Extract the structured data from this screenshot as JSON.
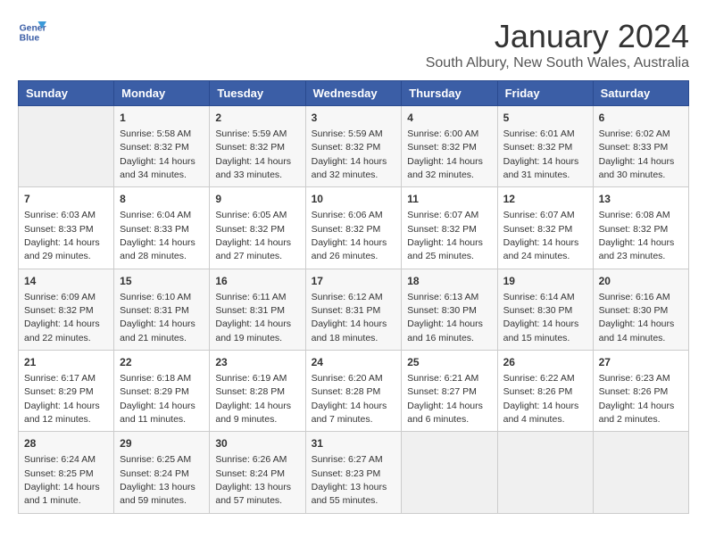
{
  "logo": {
    "line1": "General",
    "line2": "Blue"
  },
  "title": "January 2024",
  "subtitle": "South Albury, New South Wales, Australia",
  "headers": [
    "Sunday",
    "Monday",
    "Tuesday",
    "Wednesday",
    "Thursday",
    "Friday",
    "Saturday"
  ],
  "weeks": [
    [
      {
        "day": "",
        "info": ""
      },
      {
        "day": "1",
        "info": "Sunrise: 5:58 AM\nSunset: 8:32 PM\nDaylight: 14 hours\nand 34 minutes."
      },
      {
        "day": "2",
        "info": "Sunrise: 5:59 AM\nSunset: 8:32 PM\nDaylight: 14 hours\nand 33 minutes."
      },
      {
        "day": "3",
        "info": "Sunrise: 5:59 AM\nSunset: 8:32 PM\nDaylight: 14 hours\nand 32 minutes."
      },
      {
        "day": "4",
        "info": "Sunrise: 6:00 AM\nSunset: 8:32 PM\nDaylight: 14 hours\nand 32 minutes."
      },
      {
        "day": "5",
        "info": "Sunrise: 6:01 AM\nSunset: 8:32 PM\nDaylight: 14 hours\nand 31 minutes."
      },
      {
        "day": "6",
        "info": "Sunrise: 6:02 AM\nSunset: 8:33 PM\nDaylight: 14 hours\nand 30 minutes."
      }
    ],
    [
      {
        "day": "7",
        "info": "Sunrise: 6:03 AM\nSunset: 8:33 PM\nDaylight: 14 hours\nand 29 minutes."
      },
      {
        "day": "8",
        "info": "Sunrise: 6:04 AM\nSunset: 8:33 PM\nDaylight: 14 hours\nand 28 minutes."
      },
      {
        "day": "9",
        "info": "Sunrise: 6:05 AM\nSunset: 8:32 PM\nDaylight: 14 hours\nand 27 minutes."
      },
      {
        "day": "10",
        "info": "Sunrise: 6:06 AM\nSunset: 8:32 PM\nDaylight: 14 hours\nand 26 minutes."
      },
      {
        "day": "11",
        "info": "Sunrise: 6:07 AM\nSunset: 8:32 PM\nDaylight: 14 hours\nand 25 minutes."
      },
      {
        "day": "12",
        "info": "Sunrise: 6:07 AM\nSunset: 8:32 PM\nDaylight: 14 hours\nand 24 minutes."
      },
      {
        "day": "13",
        "info": "Sunrise: 6:08 AM\nSunset: 8:32 PM\nDaylight: 14 hours\nand 23 minutes."
      }
    ],
    [
      {
        "day": "14",
        "info": "Sunrise: 6:09 AM\nSunset: 8:32 PM\nDaylight: 14 hours\nand 22 minutes."
      },
      {
        "day": "15",
        "info": "Sunrise: 6:10 AM\nSunset: 8:31 PM\nDaylight: 14 hours\nand 21 minutes."
      },
      {
        "day": "16",
        "info": "Sunrise: 6:11 AM\nSunset: 8:31 PM\nDaylight: 14 hours\nand 19 minutes."
      },
      {
        "day": "17",
        "info": "Sunrise: 6:12 AM\nSunset: 8:31 PM\nDaylight: 14 hours\nand 18 minutes."
      },
      {
        "day": "18",
        "info": "Sunrise: 6:13 AM\nSunset: 8:30 PM\nDaylight: 14 hours\nand 16 minutes."
      },
      {
        "day": "19",
        "info": "Sunrise: 6:14 AM\nSunset: 8:30 PM\nDaylight: 14 hours\nand 15 minutes."
      },
      {
        "day": "20",
        "info": "Sunrise: 6:16 AM\nSunset: 8:30 PM\nDaylight: 14 hours\nand 14 minutes."
      }
    ],
    [
      {
        "day": "21",
        "info": "Sunrise: 6:17 AM\nSunset: 8:29 PM\nDaylight: 14 hours\nand 12 minutes."
      },
      {
        "day": "22",
        "info": "Sunrise: 6:18 AM\nSunset: 8:29 PM\nDaylight: 14 hours\nand 11 minutes."
      },
      {
        "day": "23",
        "info": "Sunrise: 6:19 AM\nSunset: 8:28 PM\nDaylight: 14 hours\nand 9 minutes."
      },
      {
        "day": "24",
        "info": "Sunrise: 6:20 AM\nSunset: 8:28 PM\nDaylight: 14 hours\nand 7 minutes."
      },
      {
        "day": "25",
        "info": "Sunrise: 6:21 AM\nSunset: 8:27 PM\nDaylight: 14 hours\nand 6 minutes."
      },
      {
        "day": "26",
        "info": "Sunrise: 6:22 AM\nSunset: 8:26 PM\nDaylight: 14 hours\nand 4 minutes."
      },
      {
        "day": "27",
        "info": "Sunrise: 6:23 AM\nSunset: 8:26 PM\nDaylight: 14 hours\nand 2 minutes."
      }
    ],
    [
      {
        "day": "28",
        "info": "Sunrise: 6:24 AM\nSunset: 8:25 PM\nDaylight: 14 hours\nand 1 minute."
      },
      {
        "day": "29",
        "info": "Sunrise: 6:25 AM\nSunset: 8:24 PM\nDaylight: 13 hours\nand 59 minutes."
      },
      {
        "day": "30",
        "info": "Sunrise: 6:26 AM\nSunset: 8:24 PM\nDaylight: 13 hours\nand 57 minutes."
      },
      {
        "day": "31",
        "info": "Sunrise: 6:27 AM\nSunset: 8:23 PM\nDaylight: 13 hours\nand 55 minutes."
      },
      {
        "day": "",
        "info": ""
      },
      {
        "day": "",
        "info": ""
      },
      {
        "day": "",
        "info": ""
      }
    ]
  ]
}
